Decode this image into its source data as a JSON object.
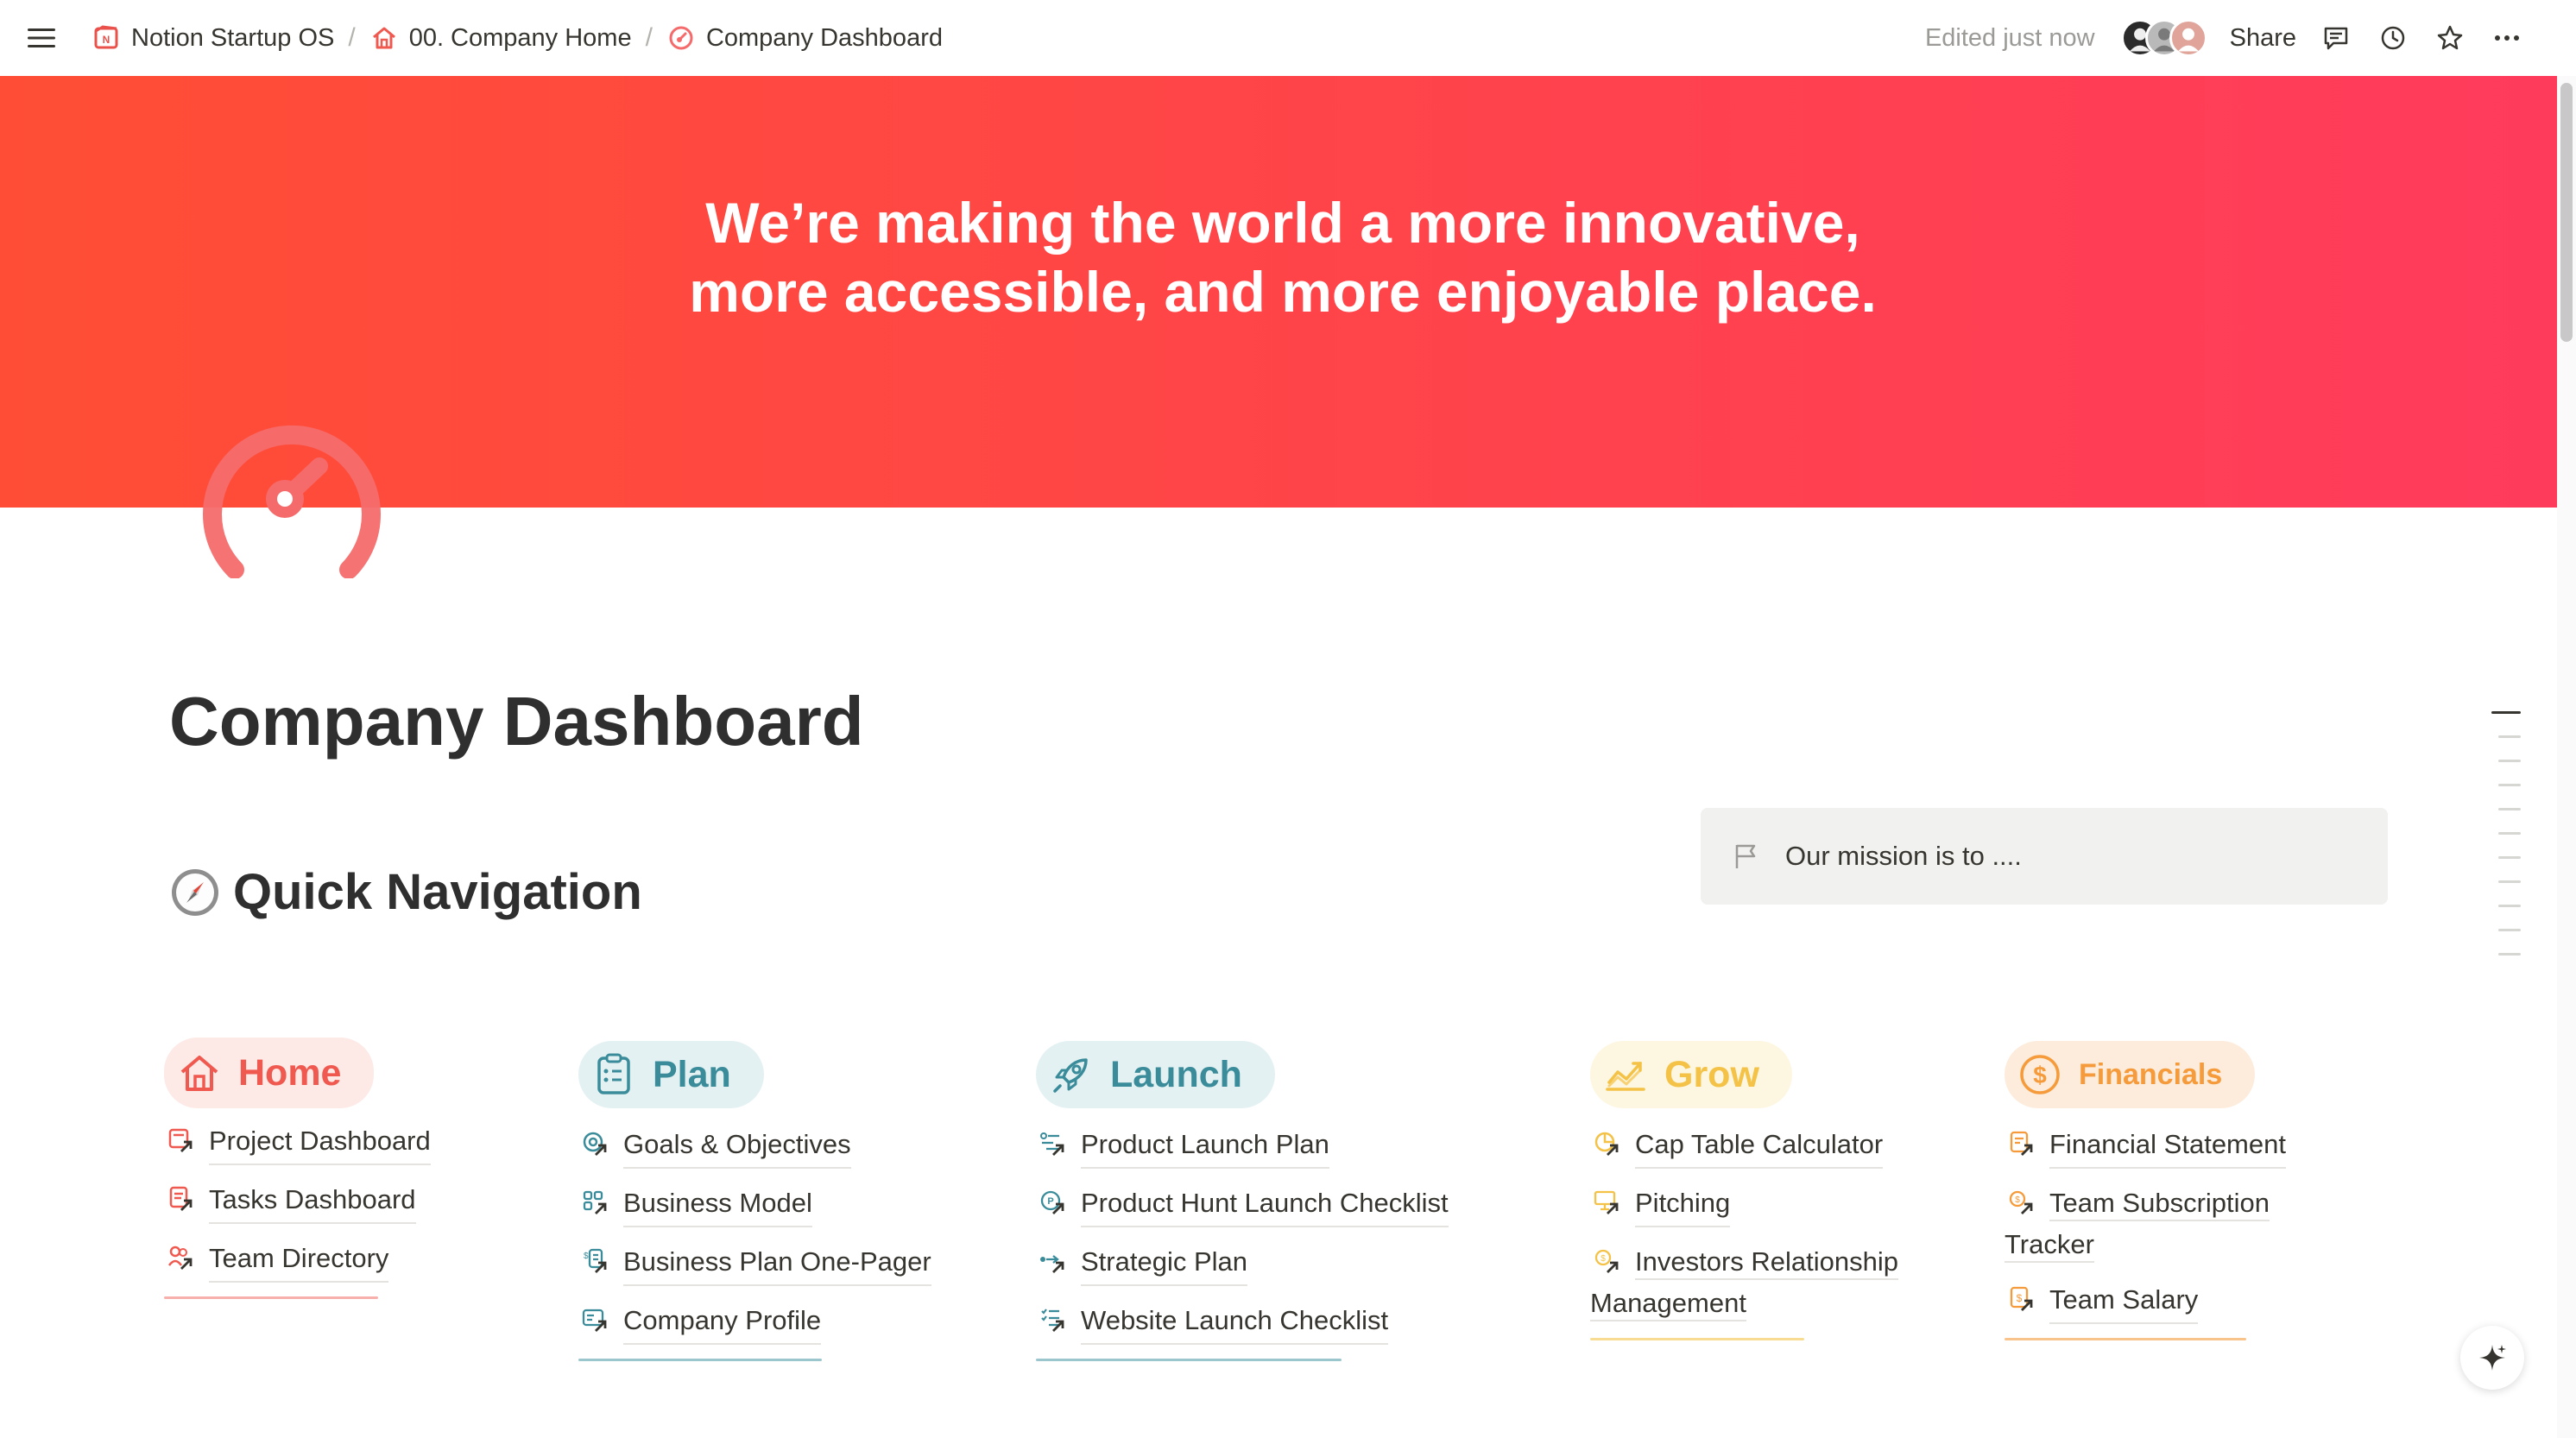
{
  "topbar": {
    "breadcrumbs": [
      {
        "label": "Notion Startup OS",
        "icon": "notion-box-icon"
      },
      {
        "label": "00. Company Home",
        "icon": "home-icon"
      },
      {
        "label": "Company Dashboard",
        "icon": "dashboard-gauge-icon"
      }
    ],
    "separator": "/",
    "edited": "Edited just now",
    "share": "Share",
    "actions": [
      "comments-icon",
      "history-clock-icon",
      "favorite-star-icon",
      "more-dots-icon"
    ]
  },
  "cover": {
    "line1": "We’re making the world a more innovative,",
    "line2": "more accessible, and more enjoyable place.",
    "colors": {
      "start": "#ff4e35",
      "end": "#ff3b5c"
    }
  },
  "page": {
    "title": "Company Dashboard",
    "icon": "dashboard-gauge-icon",
    "icon_color": "#f56b6b"
  },
  "quick_nav": {
    "heading": "Quick Navigation",
    "emoji": "compass-icon"
  },
  "callout": {
    "text": "Our mission is to ....",
    "icon": "flag-icon"
  },
  "columns": [
    {
      "title": "Home",
      "color": "#f0594f",
      "links": [
        "Project Dashboard",
        "Tasks Dashboard",
        "Team Directory"
      ]
    },
    {
      "title": "Plan",
      "color": "#3b8c9a",
      "links": [
        "Goals & Objectives",
        "Business Model",
        "Business Plan One-Pager",
        "Company Profile"
      ]
    },
    {
      "title": "Launch",
      "color": "#3b8c9a",
      "links": [
        "Product Launch Plan",
        "Product Hunt Launch Checklist",
        "Strategic Plan",
        "Website Launch Checklist"
      ]
    },
    {
      "title": "Grow",
      "color": "#f3c246",
      "links": [
        "Cap Table Calculator",
        "Pitching",
        "Investors Relationship Management"
      ]
    },
    {
      "title": "Financials",
      "color": "#f59b3b",
      "links": [
        "Financial Statement",
        "Team Subscription Tracker",
        "Team Salary"
      ]
    }
  ]
}
